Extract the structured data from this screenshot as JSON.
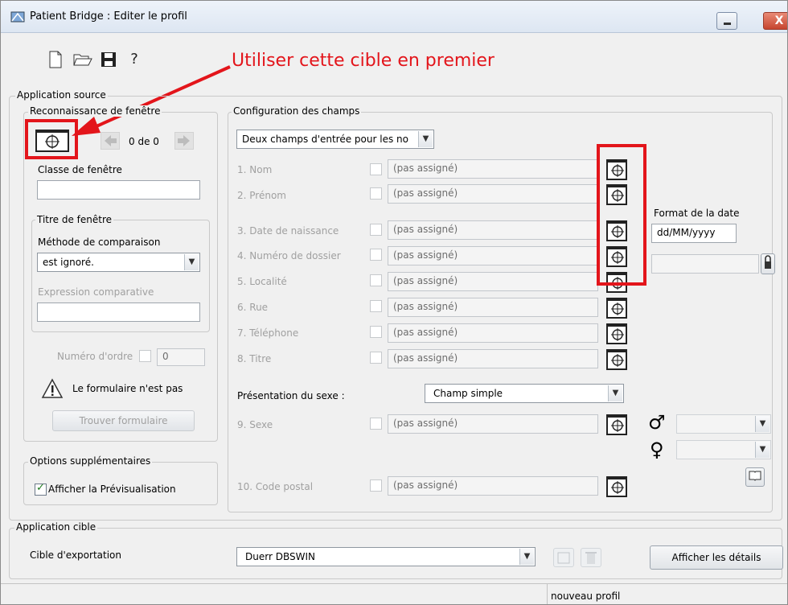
{
  "window": {
    "title": "Patient Bridge : Editer le profil",
    "close_glyph": "X"
  },
  "toolbar": {
    "new": "🗋",
    "open": "📂",
    "save": "💾",
    "help": "?"
  },
  "callout": "Utiliser cette cible en premier",
  "source": {
    "title": "Application source",
    "recognition": {
      "title": "Reconnaissance de fenêtre",
      "counter": "0 de 0",
      "class_label": "Classe de fenêtre",
      "class_value": "",
      "title_group": "Titre de fenêtre",
      "method_label": "Méthode de comparaison",
      "method_value": "est ignoré.",
      "expression_label": "Expression comparative",
      "expression_value": "",
      "order_label": "Numéro d'ordre",
      "order_value": "0",
      "warning_text": "Le formulaire n'est pas",
      "find_button": "Trouver formulaire"
    },
    "options": {
      "title": "Options supplémentaires",
      "preview_label": "Afficher la Prévisualisation",
      "preview_checked": true
    }
  },
  "fields_config": {
    "title": "Configuration des champs",
    "name_mode": "Deux champs d'entrée pour les no",
    "unassigned": "(pas assigné)",
    "fields": [
      {
        "label": "1. Nom",
        "value": "(pas assigné)"
      },
      {
        "label": "2. Prénom",
        "value": "(pas assigné)"
      },
      {
        "label": "3. Date de naissance",
        "value": "(pas assigné)"
      },
      {
        "label": "4. Numéro de dossier",
        "value": "(pas assigné)"
      },
      {
        "label": "5. Localité",
        "value": "(pas assigné)"
      },
      {
        "label": "6. Rue",
        "value": "(pas assigné)"
      },
      {
        "label": "7. Téléphone",
        "value": "(pas assigné)"
      },
      {
        "label": "8. Titre",
        "value": "(pas assigné)"
      }
    ],
    "date_format_label": "Format de la date",
    "date_format_value": "dd/MM/yyyy",
    "sex_presentation_label": "Présentation du sexe :",
    "sex_presentation_value": "Champ simple",
    "sex_field": {
      "label": "9. Sexe",
      "value": "(pas assigné)"
    },
    "male_symbol": "♂",
    "female_symbol": "♀",
    "postal_field": {
      "label": "10. Code postal",
      "value": "(pas assigné)"
    }
  },
  "target_app": {
    "title": "Application cible",
    "export_label": "Cible d'exportation",
    "export_value": "Duerr DBSWIN",
    "details_button": "Afficher les détails"
  },
  "status": {
    "profile": "nouveau profil"
  },
  "colors": {
    "annotation": "#e3151b"
  }
}
